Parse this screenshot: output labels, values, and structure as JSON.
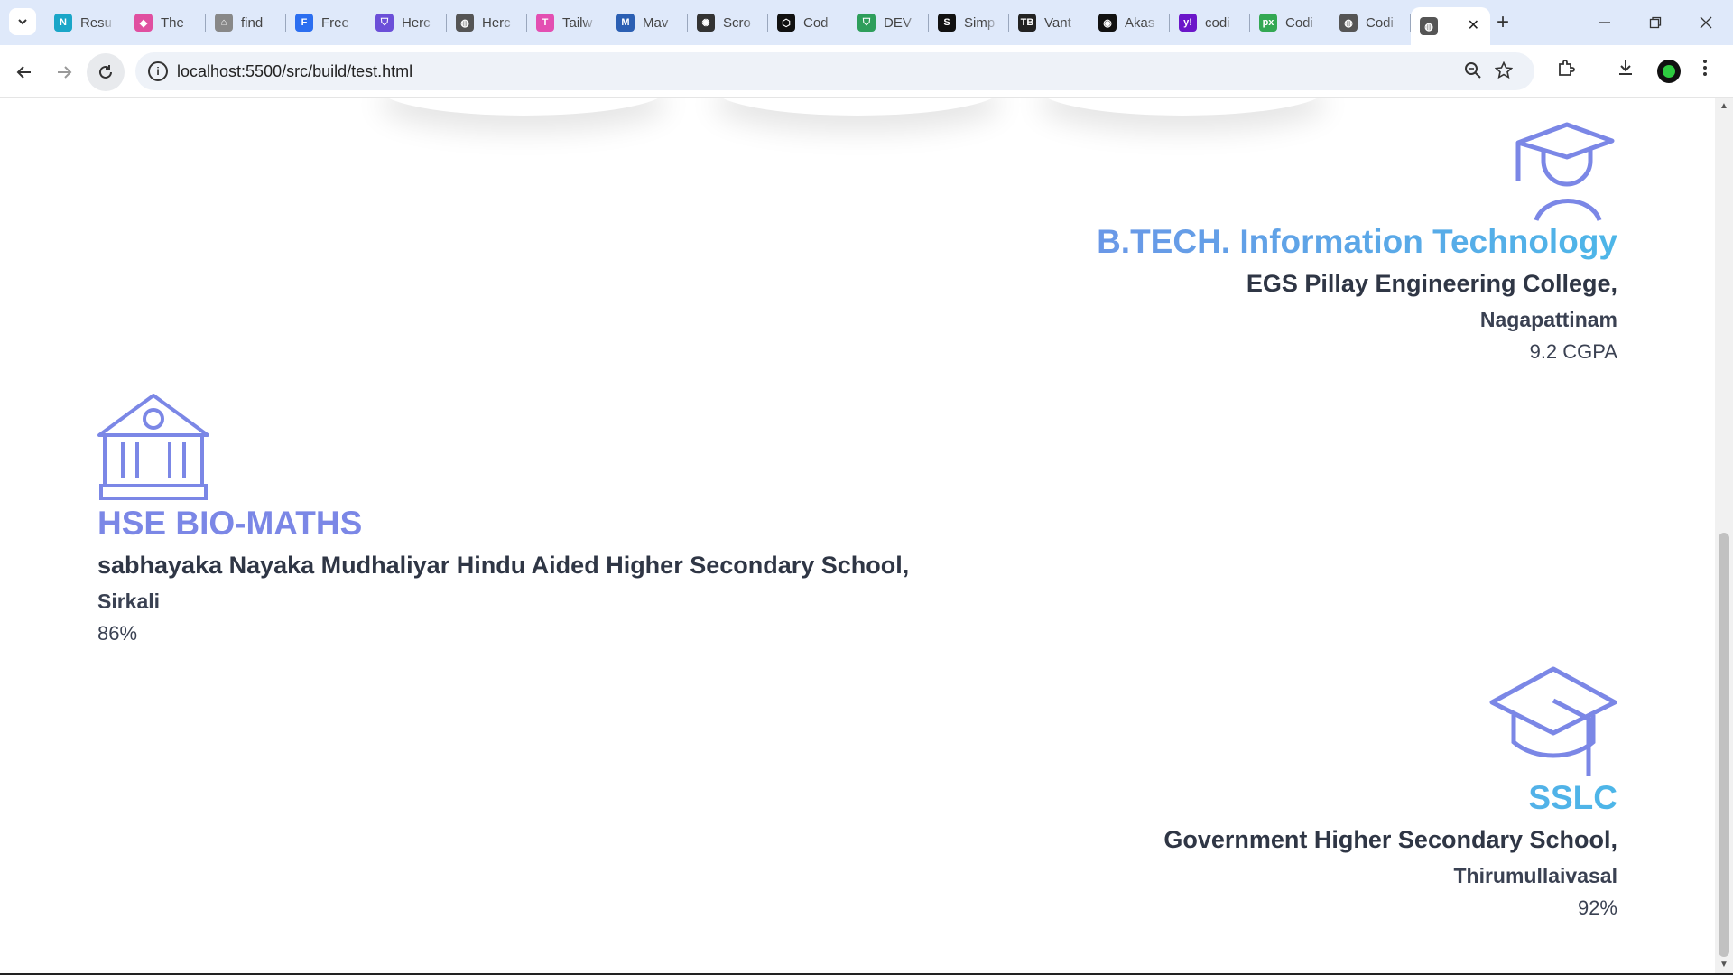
{
  "browser": {
    "tabs": [
      {
        "label": "Resu",
        "icon": "notion-n-icon",
        "color": "#1aa6c8",
        "glyph": "N"
      },
      {
        "label": "The",
        "icon": "app-logo-icon",
        "color": "#e04fa0",
        "glyph": "◆"
      },
      {
        "label": "find",
        "icon": "home-icon",
        "color": "#888888",
        "glyph": "⌂"
      },
      {
        "label": "Free",
        "icon": "form-icon",
        "color": "#2b6ef0",
        "glyph": "F"
      },
      {
        "label": "Herc",
        "icon": "shield-icon",
        "color": "#6b4fd8",
        "glyph": "⛉"
      },
      {
        "label": "Herc",
        "icon": "globe-icon",
        "color": "#555555",
        "glyph": "◍"
      },
      {
        "label": "Tailw",
        "icon": "tailwind-t-icon",
        "color": "#e34fb2",
        "glyph": "T"
      },
      {
        "label": "Mav",
        "icon": "mvn-icon",
        "color": "#2b5fb3",
        "glyph": "M"
      },
      {
        "label": "Scro",
        "icon": "openai-icon",
        "color": "#333333",
        "glyph": "✺"
      },
      {
        "label": "Cod",
        "icon": "codepen-icon",
        "color": "#111111",
        "glyph": "⬡"
      },
      {
        "label": "DEV",
        "icon": "shield-check-icon",
        "color": "#2e9e5b",
        "glyph": "⛉"
      },
      {
        "label": "Simp",
        "icon": "simple-icon",
        "color": "#111111",
        "glyph": "S"
      },
      {
        "label": "Vant",
        "icon": "tb-icon",
        "color": "#222222",
        "glyph": "TB"
      },
      {
        "label": "Akas",
        "icon": "dark-logo-icon",
        "color": "#111111",
        "glyph": "◉"
      },
      {
        "label": "codi",
        "icon": "yahoo-icon",
        "color": "#6b16c9",
        "glyph": "y!"
      },
      {
        "label": "Codi",
        "icon": "px-icon",
        "color": "#33a853",
        "glyph": "px"
      },
      {
        "label": "Codi",
        "icon": "globe-icon",
        "color": "#555555",
        "glyph": "◍"
      }
    ],
    "active_tab_icon": "globe-icon",
    "url": "localhost:5500/src/build/test.html"
  },
  "education": [
    {
      "icon": "graduate-student-icon",
      "degree": "B.TECH. Information Technology",
      "school": "EGS Pillay Engineering College,",
      "place": "Nagapattinam",
      "score": "9.2 CGPA"
    },
    {
      "icon": "school-building-icon",
      "degree": "HSE BIO-MATHS",
      "school": "sabhayaka Nayaka Mudhaliyar Hindu Aided Higher Secondary School,",
      "place": "Sirkali",
      "score": "86%"
    },
    {
      "icon": "graduation-cap-icon",
      "degree": "SSLC",
      "school": "Government Higher Secondary School,",
      "place": "Thirumullaivasal",
      "score": "92%"
    }
  ],
  "colors": {
    "accent": "#7b87e6",
    "accent2": "#4db6e8",
    "text": "#2f3645"
  }
}
